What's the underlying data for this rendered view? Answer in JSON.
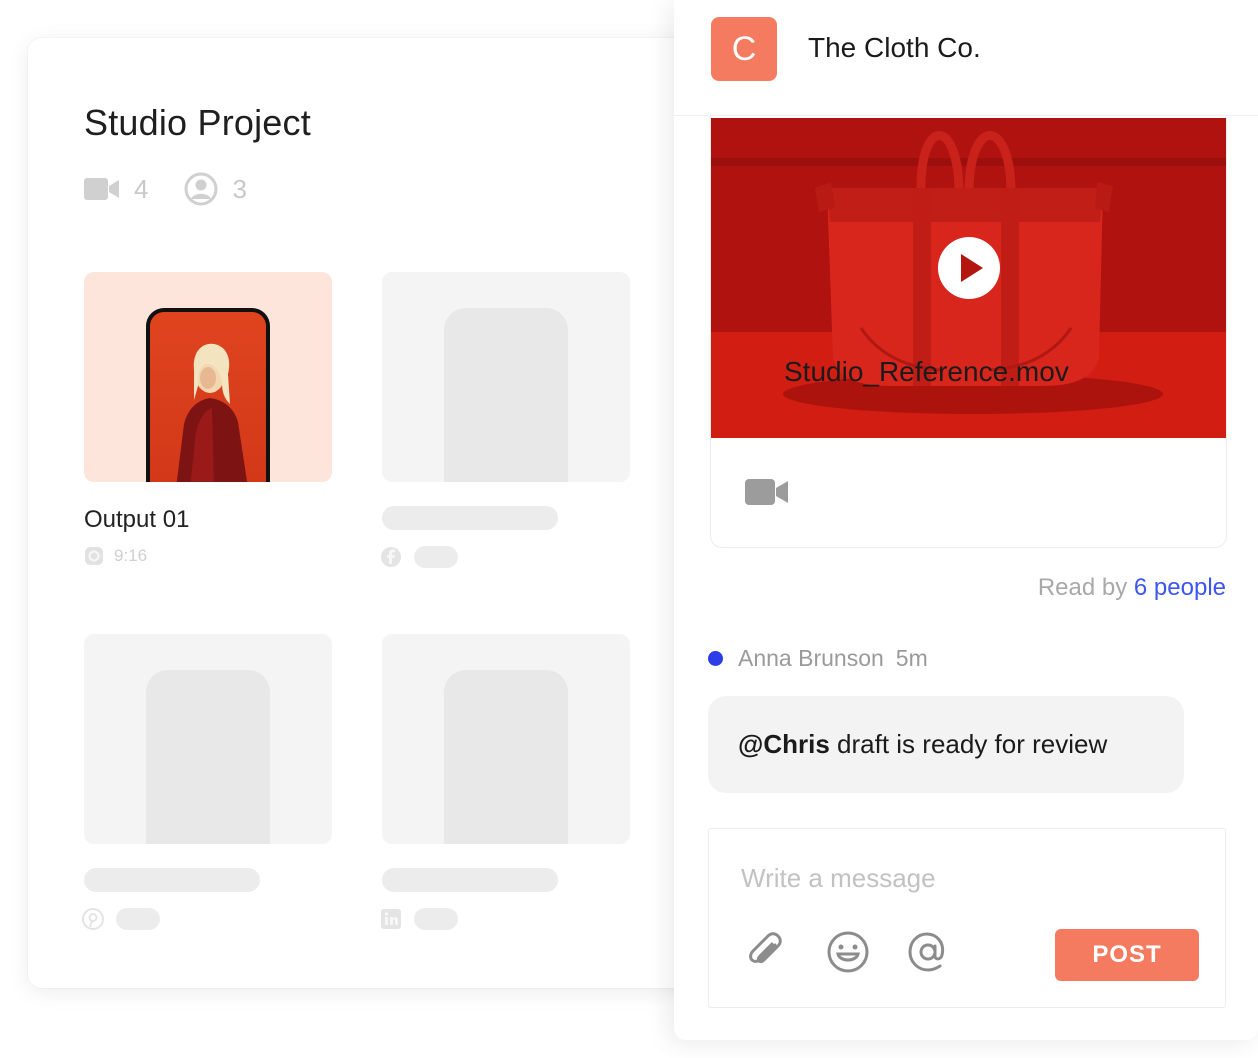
{
  "project": {
    "title": "Studio Project",
    "videos_count": "4",
    "members_count": "3",
    "outputs": [
      {
        "title": "Output 01",
        "duration": "9:16",
        "icon": "instagram-icon"
      },
      {
        "title": "",
        "duration": "",
        "icon": "facebook-icon"
      },
      {
        "title": "",
        "duration": "",
        "icon": "pinterest-icon"
      },
      {
        "title": "",
        "duration": "",
        "icon": "linkedin-icon"
      }
    ]
  },
  "chat": {
    "avatar_letter": "C",
    "company": "The Cloth Co.",
    "attachment": {
      "file_name": "Studio_Reference.mov",
      "icon": "video-camera-icon"
    },
    "read_by_prefix": "Read by",
    "read_by_link": "6 people",
    "message": {
      "author": "Anna Brunson",
      "time": "5m",
      "mention": "@Chris",
      "text": " draft is ready for review"
    },
    "composer": {
      "placeholder": "Write a message",
      "post_label": "POST"
    }
  },
  "colors": {
    "accent": "#f47b5f",
    "link": "#3d55f2",
    "unread_dot": "#2d3ee8",
    "media_red": "#c2150f"
  }
}
